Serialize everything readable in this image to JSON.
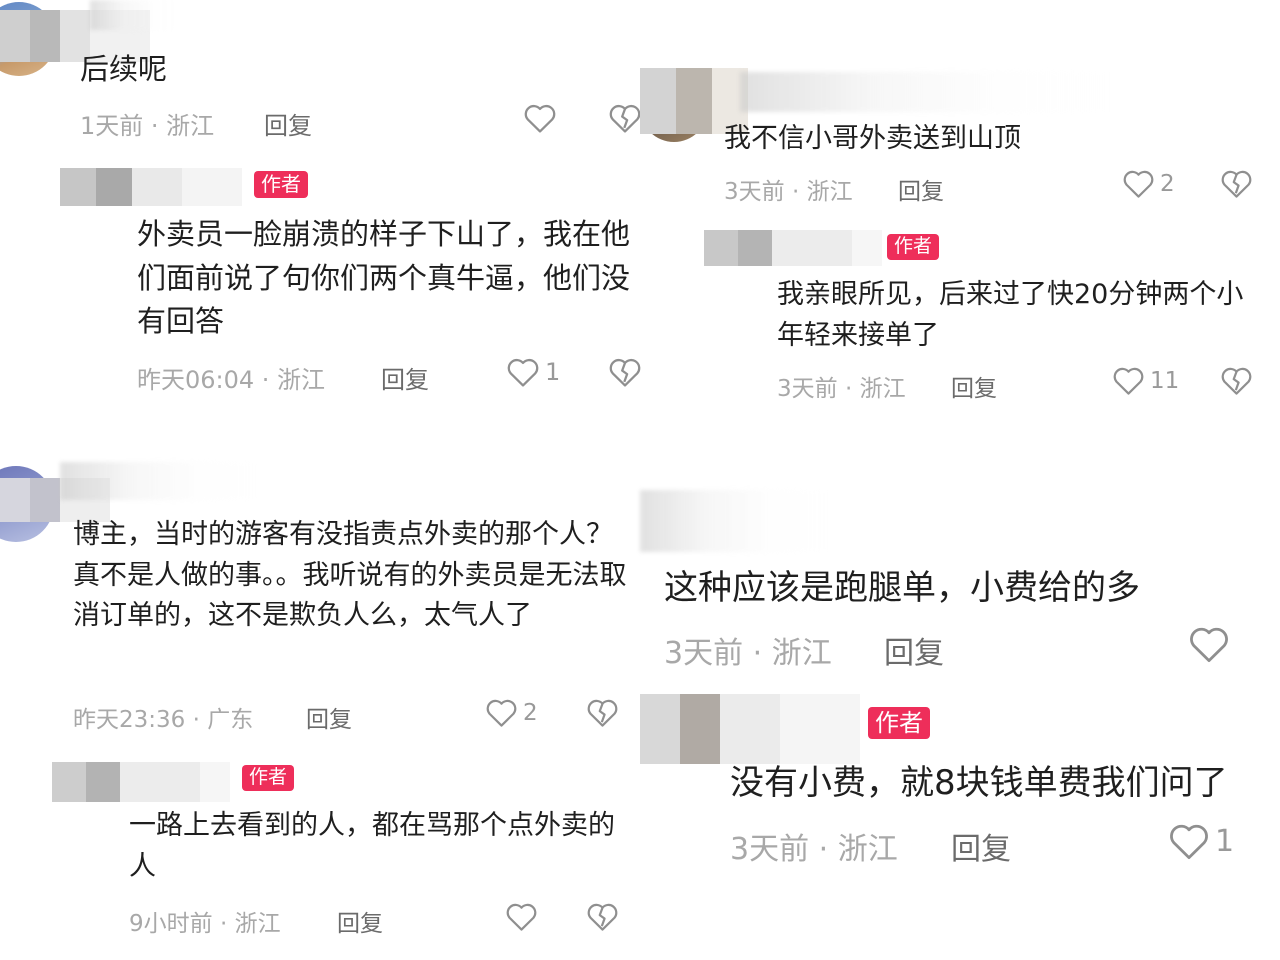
{
  "author_badge": "作者",
  "panels": [
    {
      "comment": {
        "text": "后续呢",
        "time": "1天前",
        "location": "浙江",
        "reply": "回复",
        "likes": ""
      },
      "reply": {
        "text": "外卖员一脸崩溃的样子下山了，我在他们面前说了句你们两个真牛逼，他们没有回答",
        "time": "昨天06:04",
        "location": "浙江",
        "reply": "回复",
        "likes": "1"
      }
    },
    {
      "comment": {
        "text": "我不信小哥外卖送到山顶",
        "time": "3天前",
        "location": "浙江",
        "reply": "回复",
        "likes": "2"
      },
      "reply": {
        "text": "我亲眼所见，后来过了快20分钟两个小年轻来接单了",
        "time": "3天前",
        "location": "浙江",
        "reply": "回复",
        "likes": "11"
      }
    },
    {
      "comment": {
        "text": "博主，当时的游客有没指责点外卖的那个人？真不是人做的事。。我听说有的外卖员是无法取消订单的，这不是欺负人么，太气人了",
        "time": "昨天23:36",
        "location": "广东",
        "reply": "回复",
        "likes": "2"
      },
      "reply": {
        "text": "一路上去看到的人，都在骂那个点外卖的人",
        "time": "9小时前",
        "location": "浙江",
        "reply": "回复",
        "likes": ""
      }
    },
    {
      "comment": {
        "text": "这种应该是跑腿单，小费给的多",
        "time": "3天前",
        "location": "浙江",
        "reply": "回复",
        "likes": ""
      },
      "reply": {
        "text": "没有小费，就8块钱单费我们问了",
        "time": "3天前",
        "location": "浙江",
        "reply": "回复",
        "likes": "1"
      }
    }
  ]
}
